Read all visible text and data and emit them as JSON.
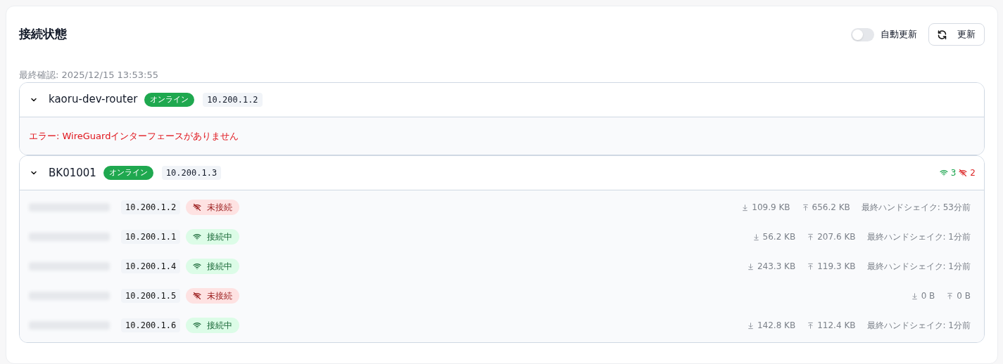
{
  "title": "接続状態",
  "auto_refresh": {
    "label": "自動更新",
    "on": false
  },
  "refresh_button": "更新",
  "last_checked": "最終確認: 2025/12/15 13:53:55",
  "routers": [
    {
      "name": "kaoru-dev-router",
      "expanded": true,
      "status": "オンライン",
      "ip": "10.200.1.2",
      "error": "エラー: WireGuardインターフェースがありません"
    },
    {
      "name": "BK01001",
      "expanded": true,
      "status": "オンライン",
      "ip": "10.200.1.3",
      "connected_count": "3",
      "disconnected_count": "2",
      "peers": [
        {
          "name_redacted": true,
          "ip": "10.200.1.2",
          "connected": false,
          "state": "未接続",
          "rx": "109.9 KB",
          "tx": "656.2 KB",
          "handshake": "最終ハンドシェイク: 53分前"
        },
        {
          "name_redacted": true,
          "ip": "10.200.1.1",
          "connected": true,
          "state": "接続中",
          "rx": "56.2 KB",
          "tx": "207.6 KB",
          "handshake": "最終ハンドシェイク: 1分前"
        },
        {
          "name_redacted": true,
          "ip": "10.200.1.4",
          "connected": true,
          "state": "接続中",
          "rx": "243.3 KB",
          "tx": "119.3 KB",
          "handshake": "最終ハンドシェイク: 1分前"
        },
        {
          "name_redacted": true,
          "ip": "10.200.1.5",
          "connected": false,
          "state": "未接続",
          "rx": "0 B",
          "tx": "0 B"
        },
        {
          "name_redacted": true,
          "ip": "10.200.1.6",
          "connected": true,
          "state": "接続中",
          "rx": "142.8 KB",
          "tx": "112.4 KB",
          "handshake": "最終ハンドシェイク: 1分前"
        }
      ]
    }
  ]
}
